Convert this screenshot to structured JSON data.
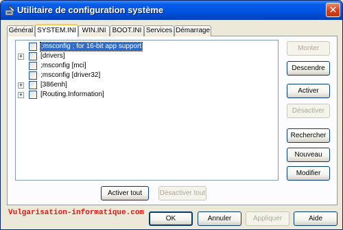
{
  "window": {
    "title": "Utilitaire de configuration système",
    "close_glyph": "✕"
  },
  "tabs": [
    {
      "label": "Général",
      "active": false
    },
    {
      "label": "SYSTEM.INI",
      "active": true
    },
    {
      "label": "WIN.INI",
      "active": false
    },
    {
      "label": "BOOT.INI",
      "active": false
    },
    {
      "label": "Services",
      "active": false
    },
    {
      "label": "Démarrage",
      "active": false
    }
  ],
  "tree": [
    {
      "label": ";msconfig ; for 16-bit app support",
      "expandable": false,
      "checked": false,
      "selected": true
    },
    {
      "label": "[drivers]",
      "expandable": true,
      "checked": false,
      "selected": false
    },
    {
      "label": ";msconfig [mci]",
      "expandable": false,
      "checked": false,
      "selected": false
    },
    {
      "label": ";msconfig [driver32]",
      "expandable": false,
      "checked": false,
      "selected": false
    },
    {
      "label": "[386enh]",
      "expandable": true,
      "checked": false,
      "selected": false
    },
    {
      "label": "[Routing.Information]",
      "expandable": true,
      "checked": false,
      "selected": false
    }
  ],
  "expander_glyph": "+",
  "side_buttons": {
    "monter": "Monter",
    "descendre": "Descendre",
    "activer": "Activer",
    "desactiver": "Désactiver",
    "rechercher": "Rechercher",
    "nouveau": "Nouveau",
    "modifier": "Modifier"
  },
  "bottom_panel_buttons": {
    "activer_tout": "Activer tout",
    "desactiver_tout": "Désactiver tout"
  },
  "watermark": "Vulgarisation-informatique.com",
  "dialog_buttons": {
    "ok": "OK",
    "annuler": "Annuler",
    "appliquer": "Appliquer",
    "aide": "Aide"
  }
}
